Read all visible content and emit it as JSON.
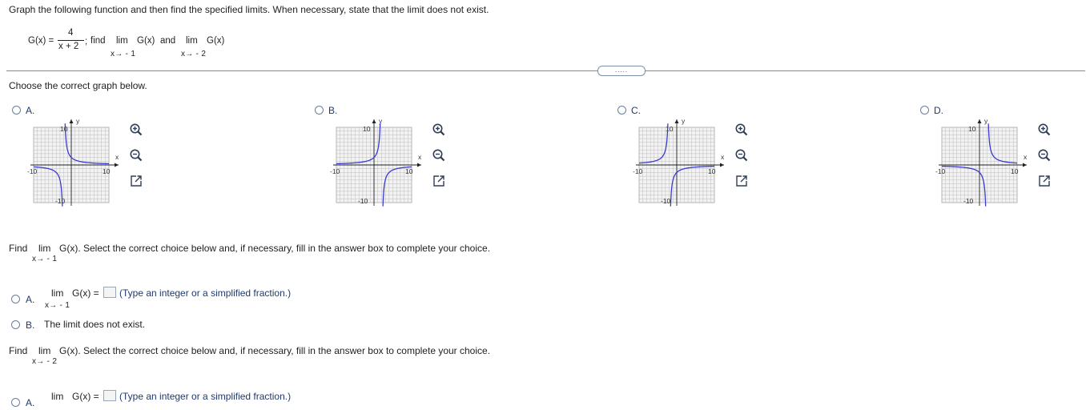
{
  "instructions": "Graph the following function and then find the specified limits. When necessary, state that the limit does not exist.",
  "function_def": {
    "lhs": "G(x) =",
    "numerator": "4",
    "denominator": "x + 2",
    "semicolon": ";",
    "find": "find",
    "lim1": "lim",
    "expr1": "G(x)",
    "and": "and",
    "lim2": "lim",
    "expr2": "G(x)",
    "sub1": "x→ - 1",
    "sub2": "x→ - 2"
  },
  "toggle_dots": ".....",
  "graph_prompt": "Choose the correct graph below.",
  "graph_options": [
    {
      "letter": "A.",
      "axis": {
        "y": "y",
        "x": "x",
        "ytop": "10",
        "ybottom": "-10",
        "xleft": "-10",
        "xright": "10"
      }
    },
    {
      "letter": "B.",
      "axis": {
        "y": "y",
        "x": "x",
        "ytop": "10",
        "ybottom": "-10",
        "xleft": "-10",
        "xright": "10"
      }
    },
    {
      "letter": "C.",
      "axis": {
        "y": "y",
        "x": "x",
        "ytop": "10",
        "ybottom": "-10",
        "xleft": "-10",
        "xright": "10"
      }
    },
    {
      "letter": "D.",
      "axis": {
        "y": "y",
        "x": "x",
        "ytop": "10",
        "ybottom": "-10",
        "xleft": "-10",
        "xright": "10"
      }
    }
  ],
  "q1": {
    "find": "Find",
    "lim": "lim",
    "expr": "G(x). Select the correct choice below and, if necessary, fill in the answer box to complete your choice.",
    "sub": "x→ - 1",
    "optA_letter": "A.",
    "optA_lim": "lim",
    "optA_expr": "G(x) =",
    "optA_sub": "x→ - 1",
    "optA_hint": "(Type an integer or a simplified fraction.)",
    "optB_letter": "B.",
    "optB_text": "The limit does not exist."
  },
  "q2": {
    "find": "Find",
    "lim": "lim",
    "expr": "G(x). Select the correct choice below and, if necessary, fill in the answer box to complete your choice.",
    "sub": "x→ - 2",
    "optA_letter": "A.",
    "optA_lim": "lim",
    "optA_expr": "G(x) =",
    "optA_hint": "(Type an integer or a simplified fraction.)"
  },
  "colors": {
    "curve": "#3a3ad0",
    "grid": "#b8b8b8",
    "accent": "#1f3a6e"
  },
  "icons": [
    "zoom-in-icon",
    "zoom-out-icon",
    "external-link-icon"
  ]
}
